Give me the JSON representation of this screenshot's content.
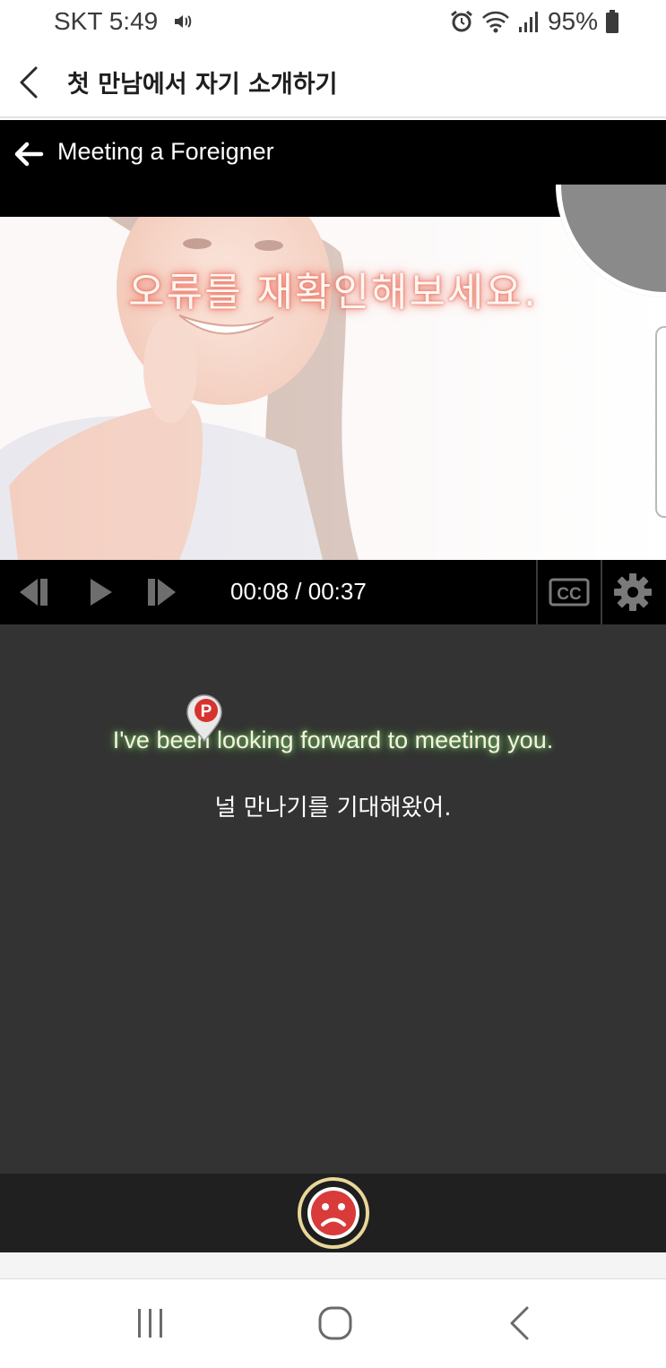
{
  "status_bar": {
    "carrier_time": "SKT 5:49",
    "battery": "95%"
  },
  "header": {
    "title": "첫 만남에서 자기 소개하기"
  },
  "video": {
    "title": "Meeting a Foreigner",
    "overlay_message": "오류를 재확인해보세요.",
    "time_display": "00:08 / 00:37",
    "cc_label": "CC"
  },
  "subtitles": {
    "english": "I've been looking forward to meeting you.",
    "korean": "널 만나기를 기대해왔어.",
    "pin_label": "P"
  },
  "colors": {
    "overlay_glow": "#e87060",
    "english_glow": "#5fa84a",
    "sad_button_fill": "#d93a3a",
    "sad_button_ring": "#e8d79a",
    "panel_bg": "#333333"
  },
  "icons": {
    "status": [
      "volume-icon",
      "alarm-icon",
      "wifi-icon",
      "signal-icon",
      "battery-icon"
    ],
    "controls": [
      "previous-sentence-icon",
      "play-icon",
      "next-sentence-icon",
      "cc-icon",
      "gear-icon"
    ],
    "nav": [
      "recent-apps-icon",
      "home-icon",
      "back-icon"
    ]
  }
}
